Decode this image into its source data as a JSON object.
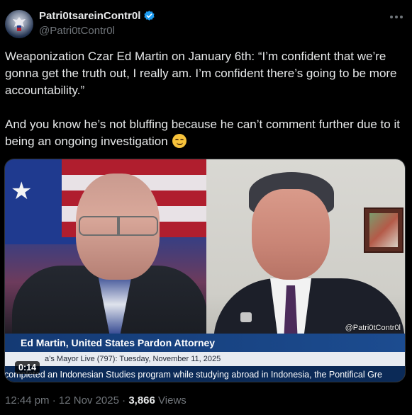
{
  "author": {
    "display_name": "Patri0tsareinContr0l",
    "handle": "@Patri0tContr0l",
    "verified": true,
    "avatar_icon": "eagle-avatar-icon"
  },
  "tweet": {
    "paragraph1": "Weaponization Czar Ed Martin on January 6th: “I’m confident that we’re gonna get the truth out, I really am. I’m confident there’s going to be more accountability.”",
    "paragraph2": "And you know he’s not bluffing because he can’t comment further due to it being an ongoing investigation",
    "emoji": "relieved-face-emoji"
  },
  "video": {
    "watermark": "@Patri0tContr0l",
    "lower_third_name": "Ed Martin, United States Pardon Attorney",
    "info_line": "a’s Mayor Live (797): Tuesday, November 11, 2025",
    "ticker": "completed an Indonesian Studies program while studying abroad in Indonesia, the Pontifical Gre",
    "timestamp": "0:14"
  },
  "meta": {
    "time": "12:44 pm",
    "separator": "·",
    "date": "12 Nov 2025",
    "views_count": "3,866",
    "views_label": "Views"
  },
  "colors": {
    "background": "#000000",
    "text": "#e7e9ea",
    "muted": "#71767b",
    "verified": "#1d9bf0"
  }
}
